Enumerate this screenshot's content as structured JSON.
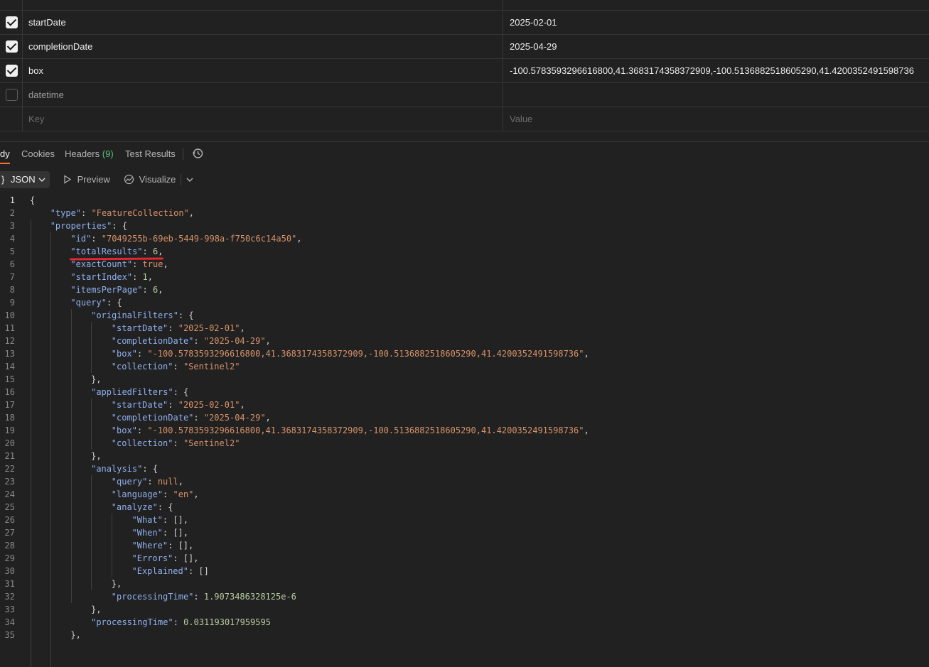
{
  "params": {
    "rows": [
      {
        "checked": true,
        "key": "startDate",
        "value": "2025-02-01"
      },
      {
        "checked": true,
        "key": "completionDate",
        "value": "2025-04-29"
      },
      {
        "checked": true,
        "key": "box",
        "value": "-100.5783593296616800,41.3683174358372909,-100.5136882518605290,41.4200352491598736"
      },
      {
        "checked": false,
        "key": "datetime",
        "value": ""
      }
    ],
    "key_placeholder": "Key",
    "value_placeholder": "Value"
  },
  "response_tabs": {
    "body": "dy",
    "cookies": "Cookies",
    "headers": "Headers",
    "headers_count": "(9)",
    "test_results": "Test Results"
  },
  "toolbar": {
    "format_brace": "}",
    "format": "JSON",
    "preview": "Preview",
    "visualize": "Visualize"
  },
  "json_lines": [
    {
      "n": "1",
      "indent": 0,
      "parts": [
        [
          "p",
          "{"
        ]
      ]
    },
    {
      "n": "2",
      "indent": 1,
      "parts": [
        [
          "k",
          "\"type\""
        ],
        [
          "p",
          ": "
        ],
        [
          "s",
          "\"FeatureCollection\""
        ],
        [
          "p",
          ","
        ]
      ]
    },
    {
      "n": "3",
      "indent": 1,
      "parts": [
        [
          "k",
          "\"properties\""
        ],
        [
          "p",
          ": {"
        ]
      ]
    },
    {
      "n": "4",
      "indent": 2,
      "parts": [
        [
          "k",
          "\"id\""
        ],
        [
          "p",
          ": "
        ],
        [
          "s",
          "\"7049255b-69eb-5449-998a-f750c6c14a50\""
        ],
        [
          "p",
          ","
        ]
      ]
    },
    {
      "n": "5",
      "indent": 2,
      "parts": [
        [
          "k",
          "\"totalResults\""
        ],
        [
          "p",
          ": "
        ],
        [
          "n",
          "6"
        ],
        [
          "p",
          ","
        ]
      ]
    },
    {
      "n": "6",
      "indent": 2,
      "parts": [
        [
          "k",
          "\"exactCount\""
        ],
        [
          "p",
          ": "
        ],
        [
          "kw",
          "true"
        ],
        [
          "p",
          ","
        ]
      ]
    },
    {
      "n": "7",
      "indent": 2,
      "parts": [
        [
          "k",
          "\"startIndex\""
        ],
        [
          "p",
          ": "
        ],
        [
          "n",
          "1"
        ],
        [
          "p",
          ","
        ]
      ]
    },
    {
      "n": "8",
      "indent": 2,
      "parts": [
        [
          "k",
          "\"itemsPerPage\""
        ],
        [
          "p",
          ": "
        ],
        [
          "n",
          "6"
        ],
        [
          "p",
          ","
        ]
      ]
    },
    {
      "n": "9",
      "indent": 2,
      "parts": [
        [
          "k",
          "\"query\""
        ],
        [
          "p",
          ": {"
        ]
      ]
    },
    {
      "n": "10",
      "indent": 3,
      "parts": [
        [
          "k",
          "\"originalFilters\""
        ],
        [
          "p",
          ": {"
        ]
      ]
    },
    {
      "n": "11",
      "indent": 4,
      "parts": [
        [
          "k",
          "\"startDate\""
        ],
        [
          "p",
          ": "
        ],
        [
          "s",
          "\"2025-02-01\""
        ],
        [
          "p",
          ","
        ]
      ]
    },
    {
      "n": "12",
      "indent": 4,
      "parts": [
        [
          "k",
          "\"completionDate\""
        ],
        [
          "p",
          ": "
        ],
        [
          "s",
          "\"2025-04-29\""
        ],
        [
          "p",
          ","
        ]
      ]
    },
    {
      "n": "13",
      "indent": 4,
      "parts": [
        [
          "k",
          "\"box\""
        ],
        [
          "p",
          ": "
        ],
        [
          "s",
          "\"-100.5783593296616800,41.3683174358372909,-100.5136882518605290,41.4200352491598736\""
        ],
        [
          "p",
          ","
        ]
      ]
    },
    {
      "n": "14",
      "indent": 4,
      "parts": [
        [
          "k",
          "\"collection\""
        ],
        [
          "p",
          ": "
        ],
        [
          "s",
          "\"Sentinel2\""
        ]
      ]
    },
    {
      "n": "15",
      "indent": 3,
      "parts": [
        [
          "p",
          "},"
        ]
      ]
    },
    {
      "n": "16",
      "indent": 3,
      "parts": [
        [
          "k",
          "\"appliedFilters\""
        ],
        [
          "p",
          ": {"
        ]
      ]
    },
    {
      "n": "17",
      "indent": 4,
      "parts": [
        [
          "k",
          "\"startDate\""
        ],
        [
          "p",
          ": "
        ],
        [
          "s",
          "\"2025-02-01\""
        ],
        [
          "p",
          ","
        ]
      ]
    },
    {
      "n": "18",
      "indent": 4,
      "parts": [
        [
          "k",
          "\"completionDate\""
        ],
        [
          "p",
          ": "
        ],
        [
          "s",
          "\"2025-04-29\""
        ],
        [
          "p",
          ","
        ]
      ]
    },
    {
      "n": "19",
      "indent": 4,
      "parts": [
        [
          "k",
          "\"box\""
        ],
        [
          "p",
          ": "
        ],
        [
          "s",
          "\"-100.5783593296616800,41.3683174358372909,-100.5136882518605290,41.4200352491598736\""
        ],
        [
          "p",
          ","
        ]
      ]
    },
    {
      "n": "20",
      "indent": 4,
      "parts": [
        [
          "k",
          "\"collection\""
        ],
        [
          "p",
          ": "
        ],
        [
          "s",
          "\"Sentinel2\""
        ]
      ]
    },
    {
      "n": "21",
      "indent": 3,
      "parts": [
        [
          "p",
          "},"
        ]
      ]
    },
    {
      "n": "22",
      "indent": 3,
      "parts": [
        [
          "k",
          "\"analysis\""
        ],
        [
          "p",
          ": {"
        ]
      ]
    },
    {
      "n": "23",
      "indent": 4,
      "parts": [
        [
          "k",
          "\"query\""
        ],
        [
          "p",
          ": "
        ],
        [
          "kw",
          "null"
        ],
        [
          "p",
          ","
        ]
      ]
    },
    {
      "n": "24",
      "indent": 4,
      "parts": [
        [
          "k",
          "\"language\""
        ],
        [
          "p",
          ": "
        ],
        [
          "s",
          "\"en\""
        ],
        [
          "p",
          ","
        ]
      ]
    },
    {
      "n": "25",
      "indent": 4,
      "parts": [
        [
          "k",
          "\"analyze\""
        ],
        [
          "p",
          ": {"
        ]
      ]
    },
    {
      "n": "26",
      "indent": 5,
      "parts": [
        [
          "k",
          "\"What\""
        ],
        [
          "p",
          ": [],"
        ]
      ]
    },
    {
      "n": "27",
      "indent": 5,
      "parts": [
        [
          "k",
          "\"When\""
        ],
        [
          "p",
          ": [],"
        ]
      ]
    },
    {
      "n": "28",
      "indent": 5,
      "parts": [
        [
          "k",
          "\"Where\""
        ],
        [
          "p",
          ": [],"
        ]
      ]
    },
    {
      "n": "29",
      "indent": 5,
      "parts": [
        [
          "k",
          "\"Errors\""
        ],
        [
          "p",
          ": [],"
        ]
      ]
    },
    {
      "n": "30",
      "indent": 5,
      "parts": [
        [
          "k",
          "\"Explained\""
        ],
        [
          "p",
          ": []"
        ]
      ]
    },
    {
      "n": "31",
      "indent": 4,
      "parts": [
        [
          "p",
          "},"
        ]
      ]
    },
    {
      "n": "32",
      "indent": 4,
      "parts": [
        [
          "k",
          "\"processingTime\""
        ],
        [
          "p",
          ": "
        ],
        [
          "n",
          "1.9073486328125e-6"
        ]
      ]
    },
    {
      "n": "33",
      "indent": 3,
      "parts": [
        [
          "p",
          "},"
        ]
      ]
    },
    {
      "n": "34",
      "indent": 3,
      "parts": [
        [
          "k",
          "\"processingTime\""
        ],
        [
          "p",
          ": "
        ],
        [
          "n",
          "0.031193017959595"
        ]
      ]
    },
    {
      "n": "35",
      "indent": 2,
      "parts": [
        [
          "p",
          "},"
        ]
      ]
    }
  ]
}
